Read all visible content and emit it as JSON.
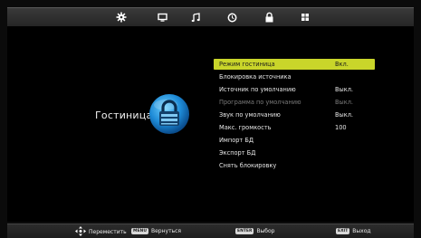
{
  "topbar": {
    "icons": [
      "gear-icon",
      "monitor-icon",
      "music-note-icon",
      "clock-icon",
      "lock-icon",
      "grid-icon"
    ],
    "active_color": "#ffffff"
  },
  "main": {
    "title": "Гостиница",
    "badge_icon": "hotel-lock-icon"
  },
  "menu": {
    "highlight_color": "#c9d52a",
    "items": [
      {
        "label": "Режим гостиница",
        "value": "Вкл."
      },
      {
        "label": "Блокировка источника",
        "value": ""
      },
      {
        "label": "Источник по умолчанию",
        "value": "Выкл."
      },
      {
        "label": "Программа по умолчанию",
        "value": "Выкл."
      },
      {
        "label": "Звук по умолчанию",
        "value": "Выкл."
      },
      {
        "label": "Макс. громкость",
        "value": "100"
      },
      {
        "label": "Импорт БД",
        "value": ""
      },
      {
        "label": "Экспорт БД",
        "value": ""
      },
      {
        "label": "Снять блокировку",
        "value": ""
      }
    ]
  },
  "footer": {
    "move": {
      "icon": "dpad-icon",
      "label": "Переместить"
    },
    "back": {
      "key": "MENU",
      "label": "Вернуться"
    },
    "select": {
      "key": "ENTER",
      "label": "Выбор"
    },
    "exit": {
      "key": "EXIT",
      "label": "Выход"
    }
  }
}
